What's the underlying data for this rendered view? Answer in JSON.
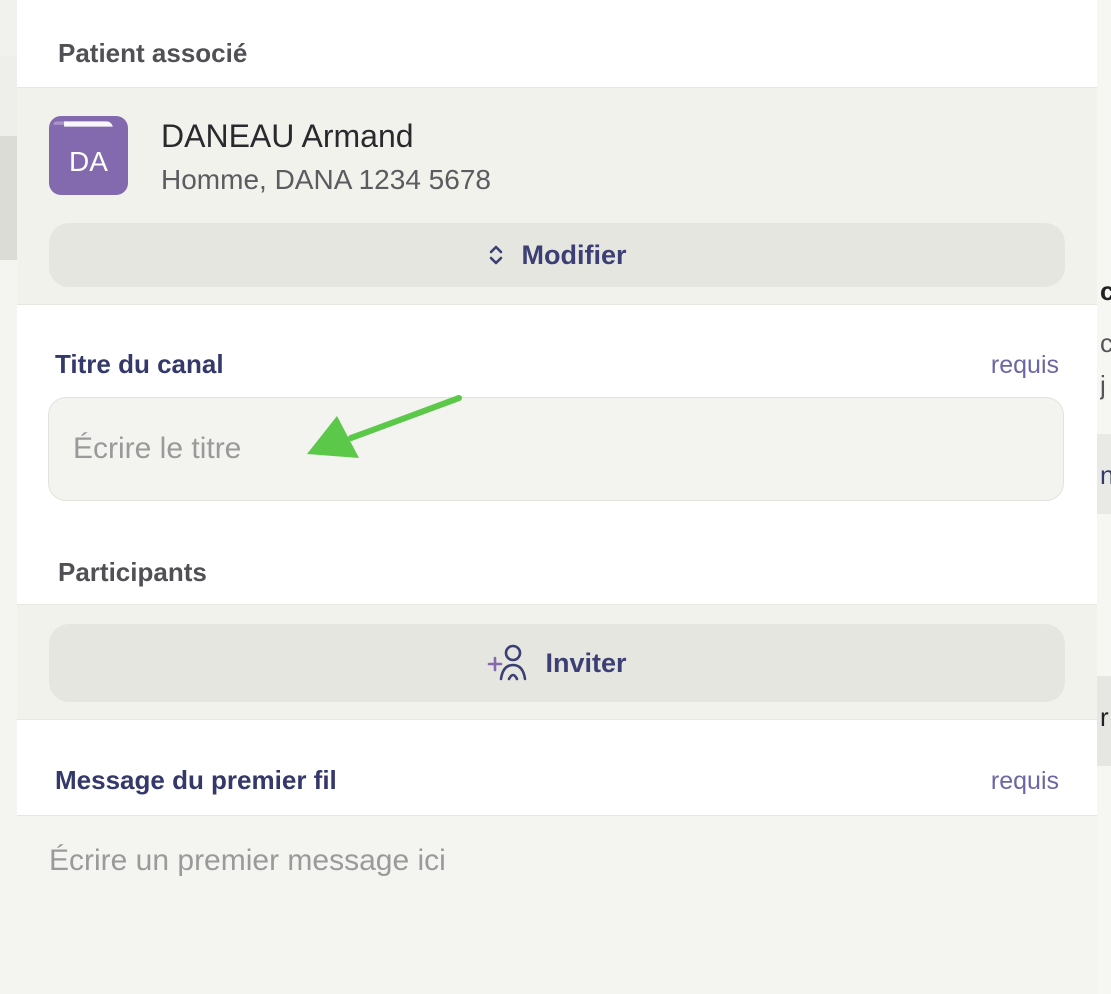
{
  "patient": {
    "section_label": "Patient associé",
    "initials": "DA",
    "name": "DANEAU Armand",
    "details": "Homme, DANA 1234 5678",
    "avatar_icon": "folder-icon",
    "modify_label": "Modifier",
    "modify_icon": "chevron-up-down-icon"
  },
  "title_field": {
    "label": "Titre du canal",
    "required_label": "requis",
    "placeholder": "Écrire le titre",
    "value": ""
  },
  "participants": {
    "section_label": "Participants",
    "invite_label": "Inviter",
    "invite_icon": "add-user-icon"
  },
  "message_field": {
    "label": "Message du premier fil",
    "required_label": "requis",
    "placeholder": "Écrire un premier message ici",
    "value": ""
  },
  "annotation": {
    "arrow_color": "#5cc84a",
    "icon": "pointer-arrow-icon"
  },
  "colors": {
    "accent": "#3b3f73",
    "avatar": "#8369ad",
    "required": "#6b67a4"
  },
  "background_fragments": [
    "c",
    "cl",
    "j",
    "ni",
    "r"
  ]
}
